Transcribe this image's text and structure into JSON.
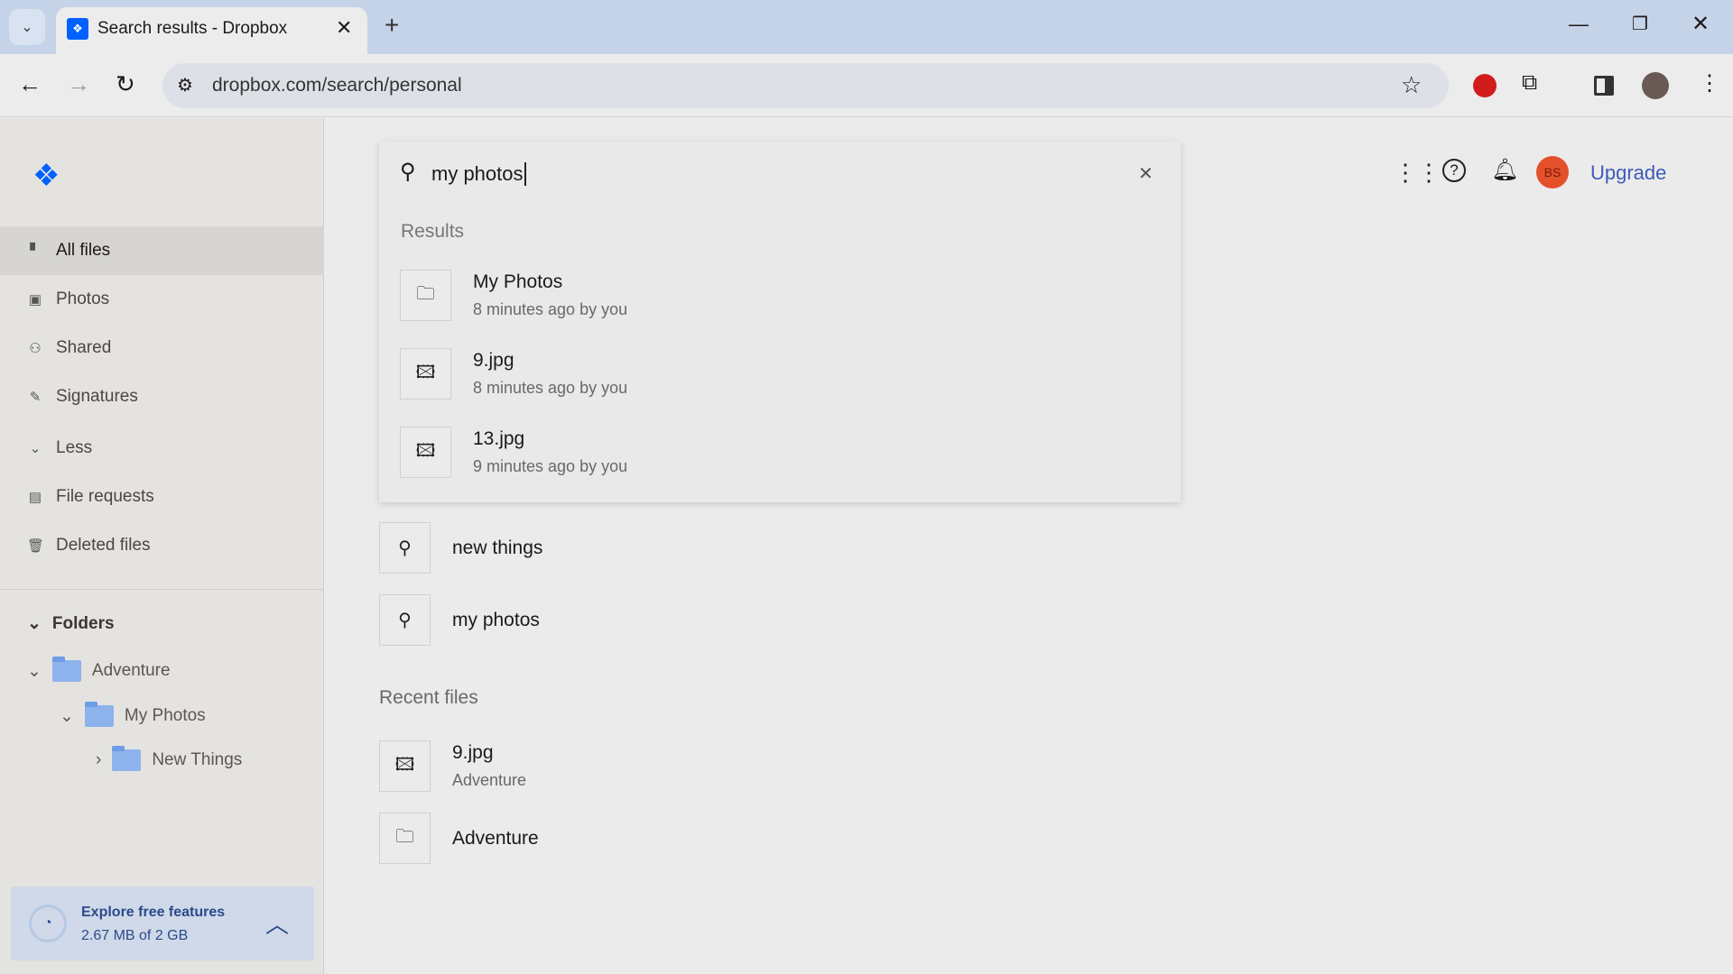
{
  "browser": {
    "tab_title": "Search results - Dropbox",
    "url": "dropbox.com/search/personal"
  },
  "sidebar": {
    "nav": [
      {
        "label": "All files",
        "icon": "all-files-icon",
        "active": true
      },
      {
        "label": "Photos",
        "icon": "photos-icon"
      },
      {
        "label": "Shared",
        "icon": "shared-icon"
      },
      {
        "label": "Signatures",
        "icon": "signatures-icon"
      },
      {
        "label": "Less",
        "icon": "chevron-down-icon"
      },
      {
        "label": "File requests",
        "icon": "file-requests-icon"
      },
      {
        "label": "Deleted files",
        "icon": "trash-icon"
      }
    ],
    "folders_label": "Folders",
    "tree": [
      {
        "label": "Adventure"
      },
      {
        "label": "My Photos"
      },
      {
        "label": "New Things"
      }
    ],
    "storage": {
      "title": "Explore free features",
      "usage": "2.67 MB of 2 GB"
    }
  },
  "search": {
    "query": "my photos",
    "results_label": "Results",
    "results": [
      {
        "name": "My Photos",
        "meta": "8 minutes ago by you",
        "type": "folder"
      },
      {
        "name": "9.jpg",
        "meta": "8 minutes ago by you",
        "type": "image"
      },
      {
        "name": "13.jpg",
        "meta": "9 minutes ago by you",
        "type": "image"
      }
    ],
    "recent_searches": [
      {
        "label": "new things"
      },
      {
        "label": "my photos"
      }
    ]
  },
  "recent": {
    "label": "Recent files",
    "items": [
      {
        "name": "9.jpg",
        "meta": "Adventure",
        "type": "image"
      },
      {
        "name": "Adventure",
        "type": "folder"
      }
    ]
  },
  "header": {
    "avatar_initials": "BS",
    "upgrade_label": "Upgrade"
  },
  "colors": {
    "accent": "#0061fe",
    "avatar": "#e4502a",
    "upgrade": "#3d5bb8"
  }
}
